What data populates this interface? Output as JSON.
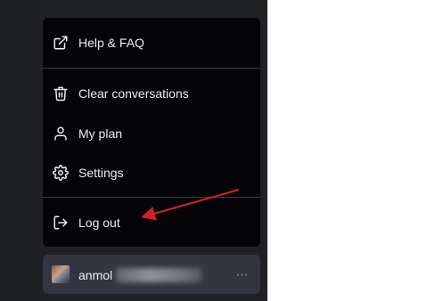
{
  "menu": {
    "help_label": "Help & FAQ",
    "clear_label": "Clear conversations",
    "plan_label": "My plan",
    "settings_label": "Settings",
    "logout_label": "Log out"
  },
  "account": {
    "username_visible": "anmol",
    "more_icon": "⋯"
  },
  "icons": {
    "help": "external-link-icon",
    "clear": "trash-icon",
    "plan": "user-icon",
    "settings": "gear-icon",
    "logout": "logout-icon"
  },
  "colors": {
    "menu_bg": "#050509",
    "sidebar_bg": "#202123",
    "account_bg": "#343541",
    "text": "#ececf1",
    "annotation_arrow": "#d62020"
  }
}
